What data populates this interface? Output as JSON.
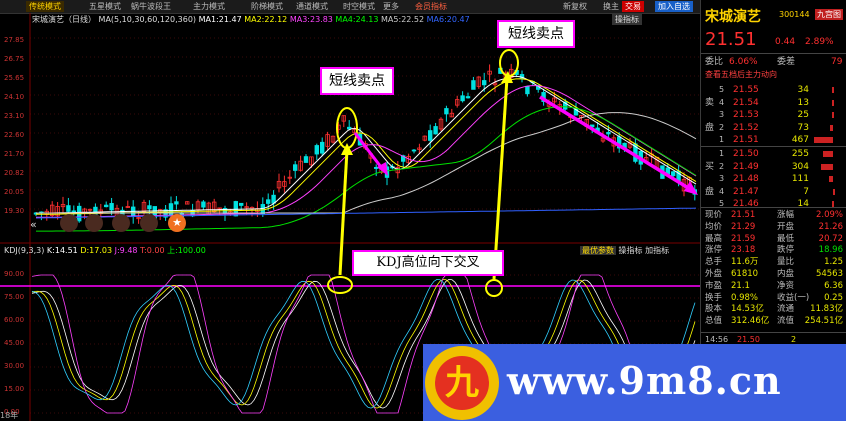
{
  "toolbar": {
    "tabs": [
      "传统模式",
      "五星模式",
      "蜗牛波段王",
      "主力模式",
      "阶梯模式",
      "通道模式",
      "时空模式",
      "更多",
      "会员指标"
    ],
    "right_buttons": [
      "新复权",
      "换主",
      "交易",
      "加入自选"
    ],
    "sub_button": "操指标"
  },
  "main_chart": {
    "stock_label": "宋城演艺（日线）",
    "ma_header": "MA(5,10,30,60,120,360)",
    "ma_values": [
      {
        "label": "MA1:21.47",
        "color": "#ffffff"
      },
      {
        "label": "MA2:22.12",
        "color": "#ffff00"
      },
      {
        "label": "MA3:23.83",
        "color": "#ff40ff"
      },
      {
        "label": "MA4:24.13",
        "color": "#00ff00"
      },
      {
        "label": "MA5:22.52",
        "color": "#cccccc"
      },
      {
        "label": "MA6:20.47",
        "color": "#3060ff"
      }
    ],
    "y_ticks": [
      "27.85",
      "26.75",
      "25.65",
      "24.10",
      "23.10",
      "22.60",
      "21.70",
      "20.82",
      "20.05",
      "19.30"
    ],
    "high_label": "27.85",
    "left_label": "21.84"
  },
  "kdj_panel": {
    "header": "KDJ(9,3,3)",
    "k": "K:14.51",
    "d": "D:17.03",
    "j": "J:9.48",
    "t": "T:0.00",
    "up": "上:100.00",
    "buttons": [
      "最优参数",
      "操指标",
      "加指标"
    ],
    "y_ticks": [
      "90.00",
      "75.00",
      "60.00",
      "45.00",
      "30.00",
      "15.00",
      "0.00"
    ],
    "bottom_label": "18年"
  },
  "annotations": {
    "sell1": "短线卖点",
    "sell2": "短线卖点",
    "kdj_cross": "KDJ高位向下交叉"
  },
  "side_panel": {
    "name": "宋城演艺",
    "code": "300144",
    "badge": "九宫图",
    "price": "21.51",
    "change": "0.44",
    "change_pct": "2.89%",
    "ratio_label": "委比",
    "ratio_value": "6.06%",
    "diff_label": "委差",
    "diff_value": "79",
    "link": "查看五档后主力动向",
    "sell": [
      {
        "tag": "5",
        "price": "21.55",
        "vol": "34"
      },
      {
        "tag": "4",
        "price": "21.54",
        "vol": "13"
      },
      {
        "tag": "3",
        "price": "21.53",
        "vol": "25"
      },
      {
        "tag": "2",
        "price": "21.52",
        "vol": "73"
      },
      {
        "tag": "1",
        "price": "21.51",
        "vol": "467"
      }
    ],
    "buy": [
      {
        "tag": "1",
        "price": "21.50",
        "vol": "255"
      },
      {
        "tag": "2",
        "price": "21.49",
        "vol": "304"
      },
      {
        "tag": "3",
        "price": "21.48",
        "vol": "111"
      },
      {
        "tag": "4",
        "price": "21.47",
        "vol": "7"
      },
      {
        "tag": "5",
        "price": "21.46",
        "vol": "14"
      }
    ],
    "sell_side_label": "卖盘",
    "buy_side_label": "买盘",
    "stats": [
      [
        "现价",
        "21.51",
        "涨幅",
        "2.09%"
      ],
      [
        "均价",
        "21.29",
        "开盘",
        "21.26"
      ],
      [
        "最高",
        "21.59",
        "最低",
        "20.72"
      ],
      [
        "涨停",
        "23.18",
        "跌停",
        "18.96"
      ],
      [
        "总手",
        "11.6万",
        "量比",
        "1.25"
      ],
      [
        "外盘",
        "61810",
        "内盘",
        "54563"
      ],
      [
        "市盈",
        "21.1",
        "净资",
        "6.36"
      ],
      [
        "换手",
        "0.98%",
        "收益(一)",
        "0.25"
      ],
      [
        "股本",
        "14.53亿",
        "流通",
        "11.83亿"
      ],
      [
        "总值",
        "312.46亿",
        "流值",
        "254.51亿"
      ]
    ],
    "tick_time": "14:56",
    "tick_price": "21.50",
    "tick_vol": "2"
  },
  "watermark": {
    "text": "www.9m8.cn",
    "logo_char": "九"
  }
}
